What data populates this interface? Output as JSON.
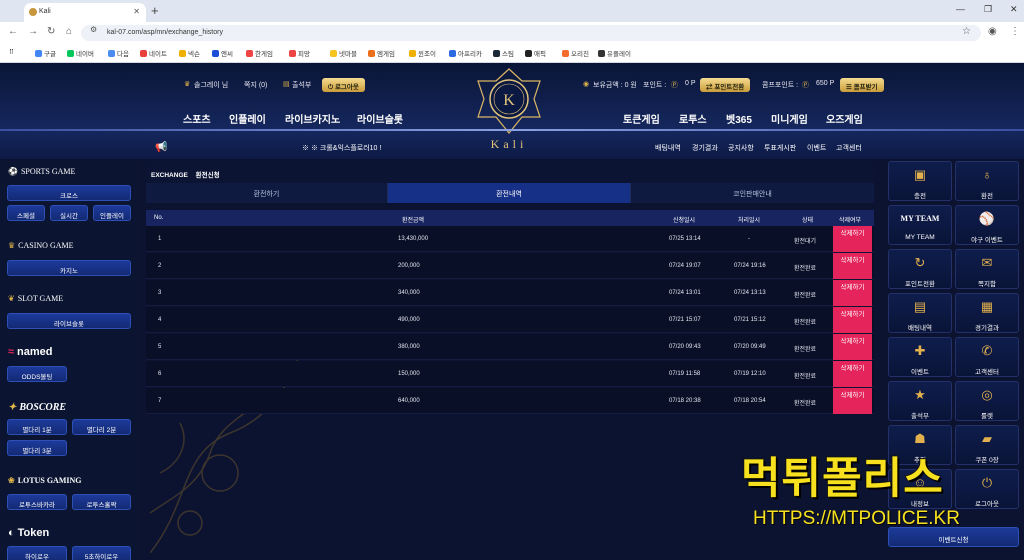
{
  "browser": {
    "tab_title": "Kali",
    "url": "kal-07.com/asp/mn/exchange_history",
    "bookmarks": [
      {
        "label": "구글",
        "color": "#4285f4"
      },
      {
        "label": "네이버",
        "color": "#03c75a"
      },
      {
        "label": "다음",
        "color": "#4a8cf0"
      },
      {
        "label": "네이트",
        "color": "#e8413c"
      },
      {
        "label": "넥슨",
        "color": "#f0b000"
      },
      {
        "label": "엔씨",
        "color": "#1d4ed8"
      },
      {
        "label": "한게임",
        "color": "#ef4444"
      },
      {
        "label": "피망",
        "color": "#ef4444"
      },
      {
        "label": "넷마블",
        "color": "#f7c41f"
      },
      {
        "label": "엠게임",
        "color": "#ec6f1c"
      },
      {
        "label": "윈조이",
        "color": "#f0b000"
      },
      {
        "label": "아프리카",
        "color": "#2d69e0"
      },
      {
        "label": "스팀",
        "color": "#1b2838"
      },
      {
        "label": "애픽",
        "color": "#222222"
      },
      {
        "label": "오리진",
        "color": "#f56c2d"
      },
      {
        "label": "유플레이",
        "color": "#333333"
      }
    ]
  },
  "header": {
    "user_name": "솔그레이 님",
    "messages": "쪽지 (0)",
    "attendance": "출석부",
    "logout": "로그아웃",
    "holding_money_label": "보유금액 : 0 원",
    "point_label": "포인트 :",
    "point_value": "0 P",
    "point_exchange": "포인트전환",
    "comp_label": "콤프포인트 :",
    "comp_value": "650 P",
    "comp_receive": "콤프받기",
    "logo_text": "Kali",
    "logo_letter": "K",
    "nav_left": [
      "스포츠",
      "인플레이",
      "라이브카지노",
      "라이브슬롯"
    ],
    "nav_right": [
      "토큰게임",
      "로투스",
      "벳365",
      "미니게임",
      "오즈게임"
    ],
    "ticker": "※ ※ 크롤&익스플로러10 !",
    "sub_links": [
      "배팅내역",
      "경기결과",
      "공지사항",
      "투표게시판",
      "이벤트",
      "고객센터"
    ]
  },
  "left_sidebar": {
    "sports_title": "SPORTS GAME",
    "sports_main": "크로스",
    "sports_items": [
      "스페셜",
      "실시간",
      "인플레이"
    ],
    "casino_title": "CASINO GAME",
    "casino_item": "카지노",
    "slot_title": "SLOT GAME",
    "slot_item": "라이브슬롯",
    "named_title": "named",
    "named_item": "ODDS볼팅",
    "boscore_title": "BOSCORE",
    "boscore_items": [
      "별다리 1분",
      "별다리 2분",
      "별다리 3분"
    ],
    "lotus_title": "LOTUS GAMING",
    "lotus_items": [
      "로투스바카라",
      "로투스홀짝"
    ],
    "token_title": "Token",
    "token_items": [
      "하이로우",
      "5초하이로우"
    ]
  },
  "main": {
    "section_en": "EXCHANGE",
    "section_ko": "환전신청",
    "tabs": [
      "환전하기",
      "환전내역",
      "코인판매안내"
    ],
    "columns": [
      "No.",
      "환전금액",
      "신청일시",
      "처리일시",
      "상태",
      "삭제여부"
    ],
    "rows": [
      {
        "no": "1",
        "amount": "13,430,000",
        "req": "07/25 13:14",
        "proc": "-",
        "status": "환전대기",
        "del": "삭제하기"
      },
      {
        "no": "2",
        "amount": "200,000",
        "req": "07/24 19:07",
        "proc": "07/24 19:16",
        "status": "환전완료",
        "del": "삭제하기"
      },
      {
        "no": "3",
        "amount": "340,000",
        "req": "07/24 13:01",
        "proc": "07/24 13:13",
        "status": "환전완료",
        "del": "삭제하기"
      },
      {
        "no": "4",
        "amount": "490,000",
        "req": "07/21 15:07",
        "proc": "07/21 15:12",
        "status": "환전완료",
        "del": "삭제하기"
      },
      {
        "no": "5",
        "amount": "380,000",
        "req": "07/20 09:43",
        "proc": "07/20 09:49",
        "status": "환전완료",
        "del": "삭제하기"
      },
      {
        "no": "6",
        "amount": "150,000",
        "req": "07/19 11:58",
        "proc": "07/19 12:10",
        "status": "환전완료",
        "del": "삭제하기"
      },
      {
        "no": "7",
        "amount": "640,000",
        "req": "07/18 20:38",
        "proc": "07/18 20:54",
        "status": "환전완료",
        "del": "삭제하기"
      }
    ]
  },
  "right_sidebar": {
    "tiles": [
      {
        "label": "충전",
        "icon": "wallet-icon",
        "glyph": "▣"
      },
      {
        "label": "환전",
        "icon": "money-bag-icon",
        "glyph": "♁"
      },
      {
        "label": "MY TEAM",
        "icon": "my-team-icon",
        "glyph": "MY TEAM"
      },
      {
        "label": "야구 이벤트",
        "icon": "baseball-icon",
        "glyph": "⚾"
      },
      {
        "label": "포인트전환",
        "icon": "refresh-icon",
        "glyph": "↻"
      },
      {
        "label": "쪽지함",
        "icon": "envelope-icon",
        "glyph": "✉"
      },
      {
        "label": "배팅내역",
        "icon": "betting-slip-icon",
        "glyph": "▤"
      },
      {
        "label": "경기결과",
        "icon": "scoreboard-icon",
        "glyph": "▦"
      },
      {
        "label": "이벤트",
        "icon": "gift-icon",
        "glyph": "✚"
      },
      {
        "label": "고객센터",
        "icon": "phone-icon",
        "glyph": "✆"
      },
      {
        "label": "출석부",
        "icon": "calendar-icon",
        "glyph": "★"
      },
      {
        "label": "룰렛",
        "icon": "roulette-icon",
        "glyph": "◎"
      },
      {
        "label": "추천",
        "icon": "users-icon",
        "glyph": "☗"
      },
      {
        "label": "쿠폰 0장",
        "icon": "coupon-icon",
        "glyph": "▰"
      },
      {
        "label": "내정보",
        "icon": "user-icon",
        "glyph": "☺"
      },
      {
        "label": "로그아웃",
        "icon": "logout-icon",
        "glyph": "⏻"
      }
    ],
    "bottom_button": "이벤트신청"
  },
  "watermark": {
    "title": "먹튀폴리스",
    "url": "HTTPS://MTPOLICE.KR"
  }
}
